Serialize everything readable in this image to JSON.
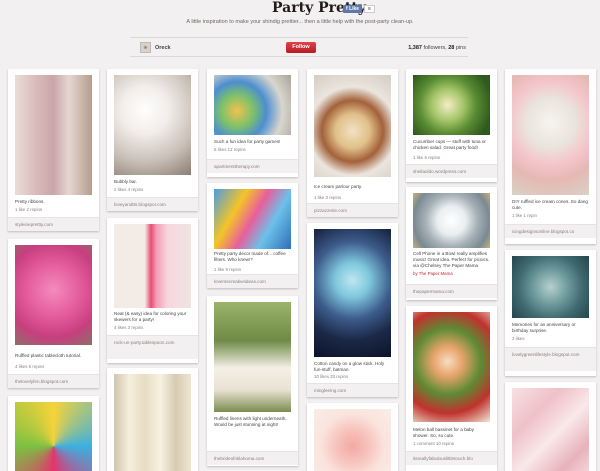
{
  "header": {
    "title": "Party Pretty",
    "like_label": "Like",
    "like_count": "8",
    "description": "A little inspiration to make your shindig prettier... then a little help with the post-party clean-up.",
    "owner": "Oreck",
    "follow_label": "Follow",
    "followers": "1,387",
    "followers_label": "followers,",
    "pins": "28",
    "pins_label": "pins"
  },
  "pins": [
    {
      "caption": "Pretty ribbons.",
      "meta": "1 like   2 repins",
      "source": "styleineprettty.com"
    },
    {
      "caption": "Ruffled plastic tablecloth tutorial.",
      "meta": "4 likes   5 repins",
      "source": "thelovelyfen.blogspot.com"
    },
    {
      "caption": "",
      "meta": "",
      "source": ""
    },
    {
      "caption": "Bubbly bar.",
      "meta": "2 likes   4 repins",
      "source": "loveyandtts.blogspot.com"
    },
    {
      "caption": "Neat (& easy) idea for coloring your skewers for a party!",
      "meta": "4 likes   3 repins",
      "source": "rock-un-party.tablespoon.com"
    },
    {
      "caption": "",
      "meta": "",
      "source": ""
    },
    {
      "caption": "Such a fun idea for party games!",
      "meta": "5 likes   12 repins",
      "source": "apartmenttherapy.com"
    },
    {
      "caption": "Pretty party decor made of... coffee filters. Who knew!?",
      "meta": "1 like   9 repins",
      "source": "loversecreativeideas.com"
    },
    {
      "caption": "Ruffled linens with light underneath. Would be just stunning at night!",
      "meta": "",
      "source": "thebrideofoklahoma.com"
    },
    {
      "caption": "Ice cream parlour party.",
      "meta": "1 like   3 repins",
      "source": "pizzazzerie.com"
    },
    {
      "caption": "Cotton candy on a glow stick. Holy fun-stuff, batman.",
      "meta": "10 likes   33 repins",
      "source": "mingleeing.com"
    },
    {
      "caption": "",
      "meta": "",
      "source": ""
    },
    {
      "caption": "Cucumber cups — stuff with tuna or chicken salad. Great party food!",
      "meta": "1 like   6 repins",
      "source": "sheilaoldo.wordpress.com"
    },
    {
      "caption": "Cell Phone in a Bowl really amplifies music! Great idea. Perfect for picnics. via @Chelsey The Paper Mama",
      "meta": "",
      "source": "thepapermama.com",
      "via": "by The Paper Mama"
    },
    {
      "caption": "Melon ball bassinet for a baby shower. So, so cute.",
      "meta": "1 comment   10 repins",
      "source": "itsreallyfabulouslittletouch.blo"
    },
    {
      "caption": "DIY ruffled ice cream cones. So dang cute.",
      "meta": "1 like   1 repin",
      "source": "icingdesignsonline.blogspot.co"
    },
    {
      "caption": "Memories for an anniversary or birthday surprise.",
      "meta": "3 likes",
      "source": "lovelygreenlifestyle.blogspot.com"
    },
    {
      "caption": "",
      "meta": "",
      "source": ""
    }
  ]
}
